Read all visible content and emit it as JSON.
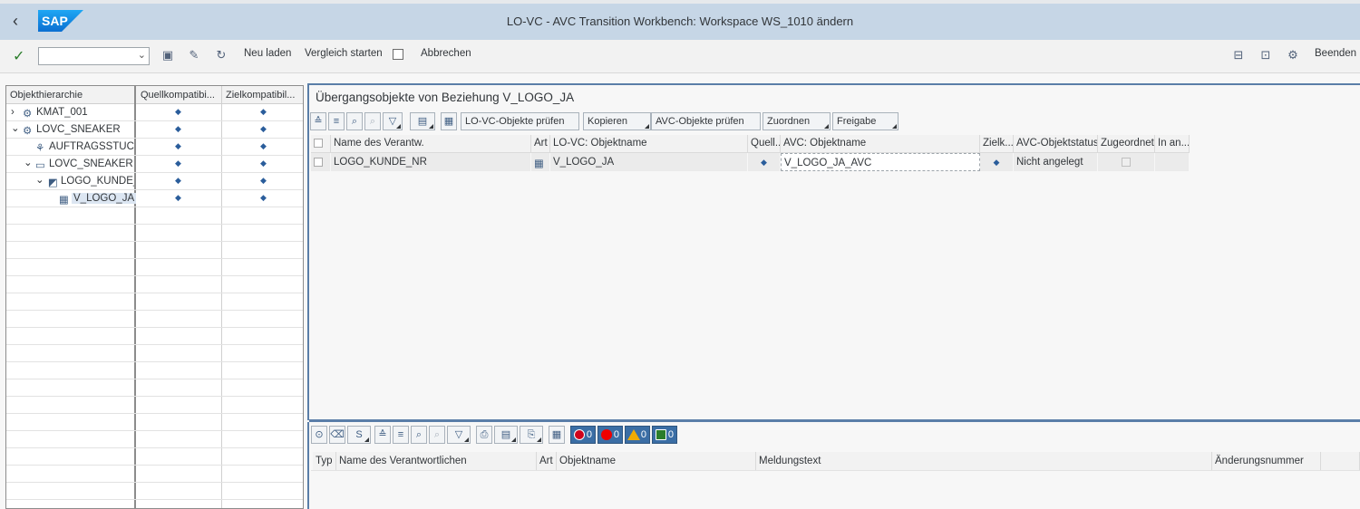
{
  "shell": {
    "title": "LO-VC - AVC Transition Workbench: Workspace WS_1010 ändern",
    "logo_text": "SAP"
  },
  "toolbar": {
    "command_field_value": "",
    "reload_label": "Neu laden",
    "compare_label": "Vergleich starten",
    "cancel_label": "Abbrechen",
    "exit_label": "Beenden"
  },
  "tree": {
    "columns": [
      "Objekthierarchie",
      "Quellkompatibi...",
      "Zielkompatibil..."
    ],
    "rows": [
      {
        "label": "KMAT_001",
        "expander": "›",
        "icon": "⚙"
      },
      {
        "label": "LOVC_SNEAKER",
        "expander": "⌄",
        "icon": "⚙"
      },
      {
        "label": "AUFTRAGSSTÜCKL",
        "expander": "",
        "icon": "⚘"
      },
      {
        "label": "LOVC_SNEAKER",
        "expander": "⌄",
        "icon": "▭"
      },
      {
        "label": "LOGO_KUNDE_NR",
        "expander": "⌄",
        "icon": "◩"
      },
      {
        "label": "V_LOGO_JA",
        "expander": "",
        "icon": "▦"
      }
    ]
  },
  "upper": {
    "title": "Übergangsobjekte von Beziehung V_LOGO_JA",
    "buttons": {
      "check_lovc": "LO-VC-Objekte prüfen",
      "copy": "Kopieren",
      "check_avc": "AVC-Objekte prüfen",
      "assign": "Zuordnen",
      "release": "Freigabe"
    },
    "columns": [
      "Name des Verantw.",
      "Art",
      "LO-VC: Objektname",
      "Quell...",
      "AVC: Objektname",
      "Zielk...",
      "AVC-Objektstatus",
      "Zugeordnet",
      "In an..."
    ],
    "rows": [
      {
        "name": "LOGO_KUNDE_NR",
        "art_icon": "variant-table-icon",
        "lovc_name": "V_LOGO_JA",
        "avc_name": "V_LOGO_JA_AVC",
        "status": "Nicht angelegt"
      }
    ]
  },
  "lower": {
    "status_counts": {
      "stop": "0",
      "error": "0",
      "warning": "0",
      "success": "0"
    },
    "columns": [
      "Typ",
      "Name des Verantwortlichen",
      "Art",
      "Objektname",
      "Meldungstext",
      "Änderungsnummer"
    ]
  },
  "colors": {
    "shell_bg": "#c6d6e6",
    "brand_blue": "#0a6ed1",
    "accent": "#3b6ea5",
    "diamond": "#2a5d9b"
  }
}
